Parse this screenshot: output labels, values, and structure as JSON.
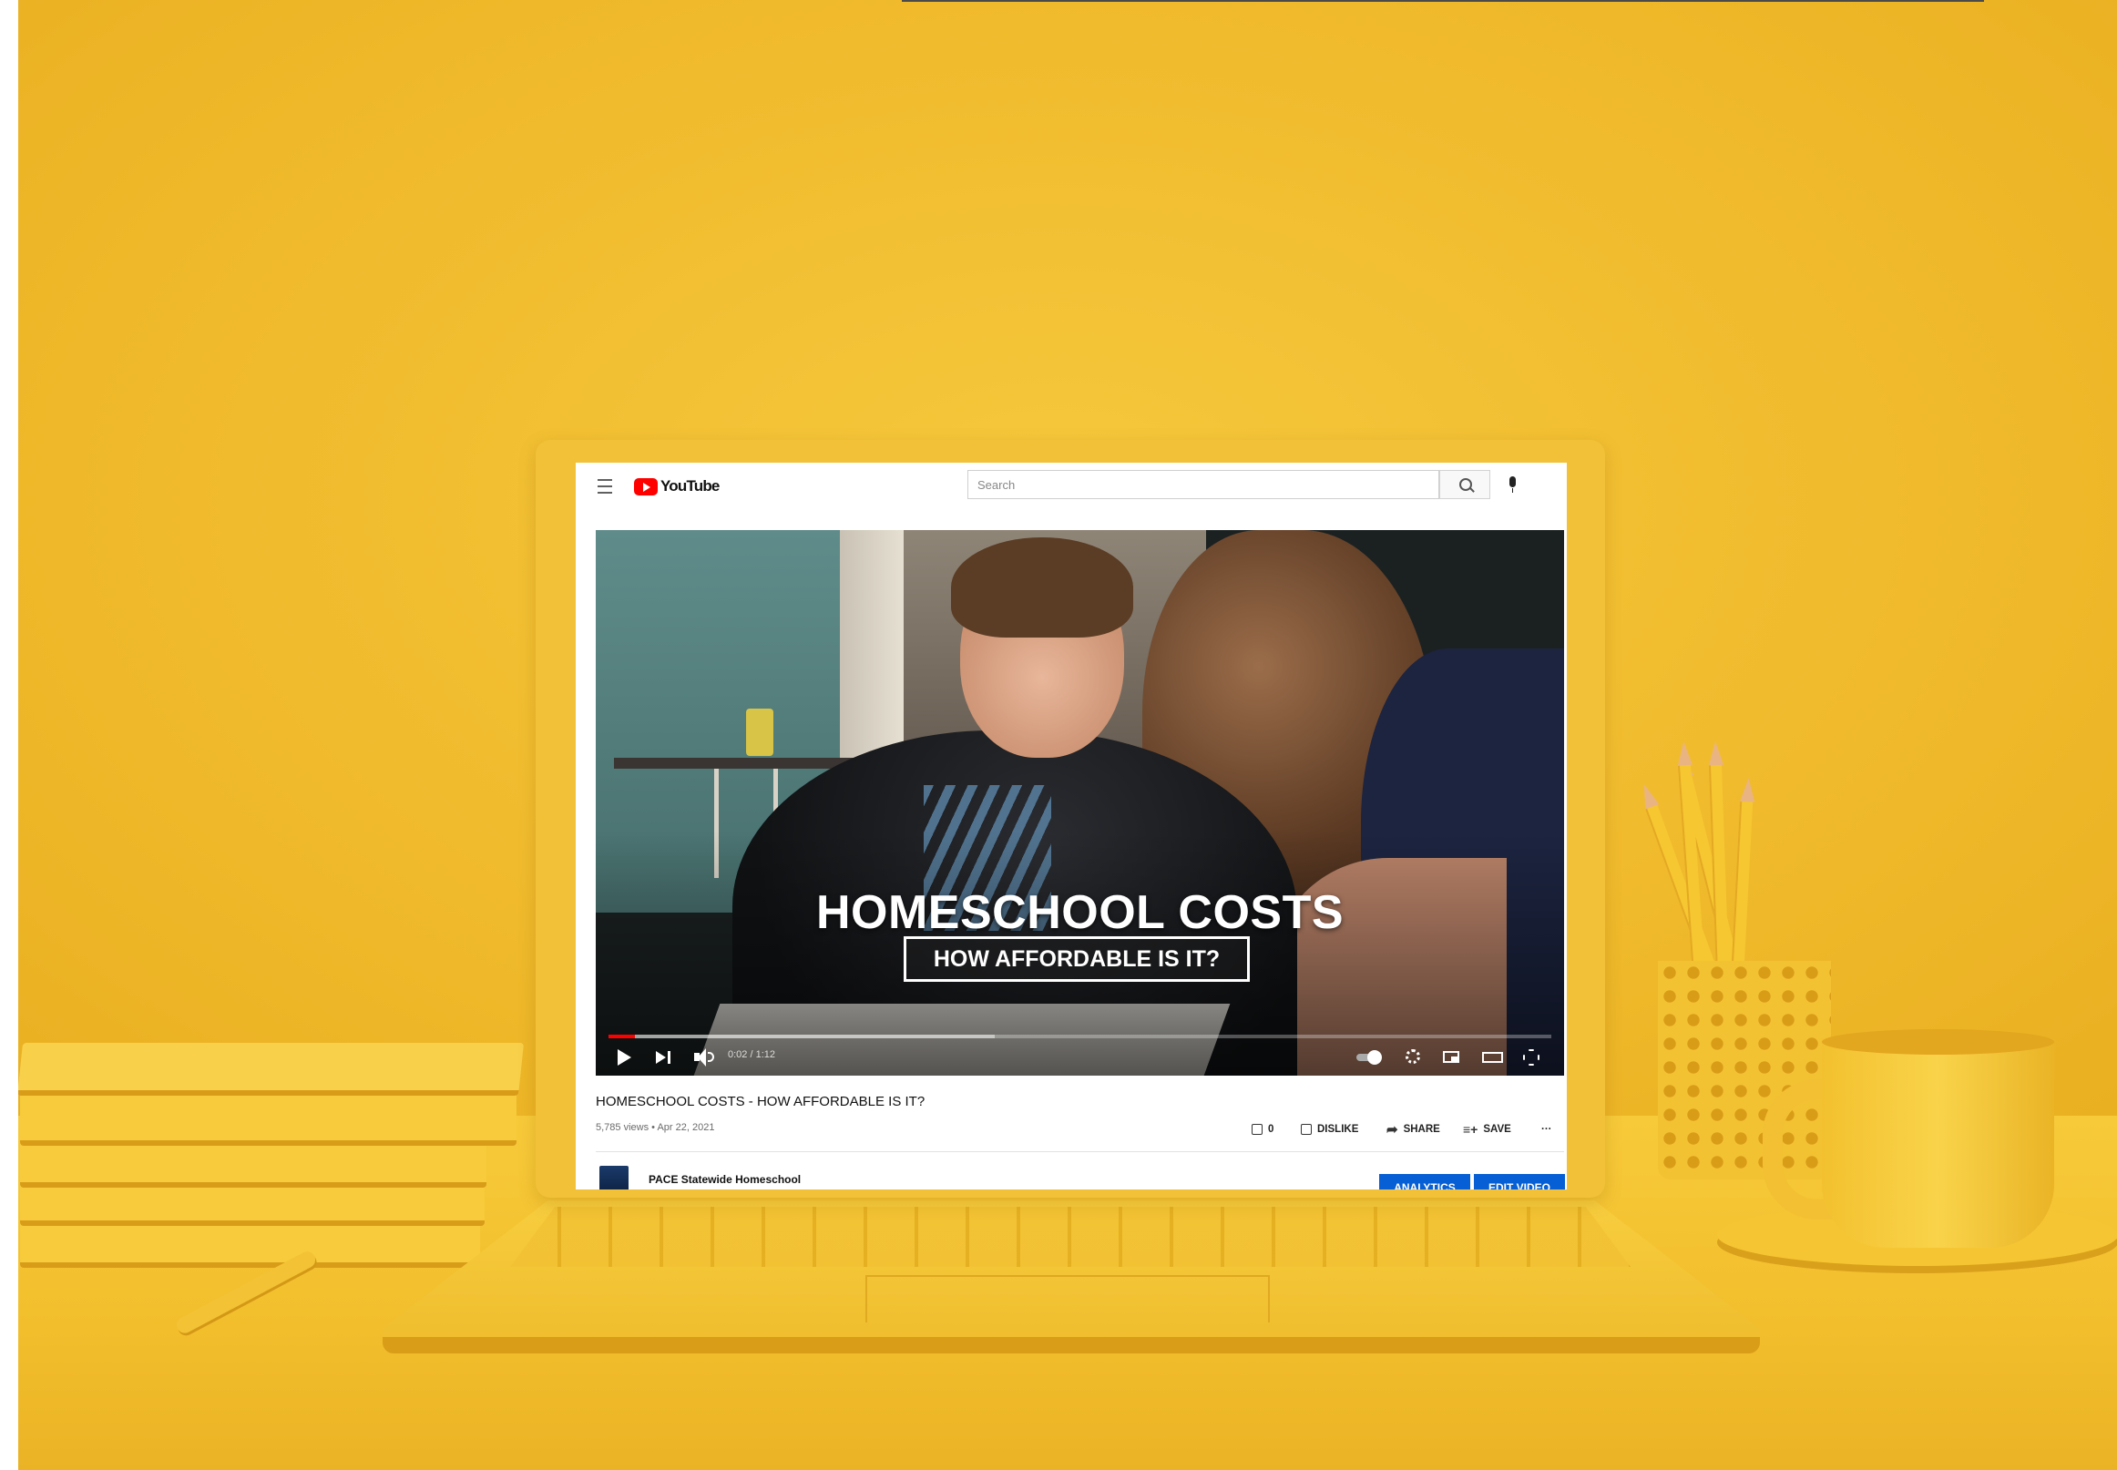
{
  "header": {
    "menu_icon": "hamburger-menu-icon",
    "logo_text": "YouTube",
    "search_placeholder": "Search",
    "search_icon": "search-icon",
    "mic_icon": "microphone-icon"
  },
  "player": {
    "overlay_title": "HOMESCHOOL COSTS",
    "overlay_subtitle": "HOW AFFORDABLE IS IT?",
    "time": "0:02 / 1:12",
    "progress_fraction": 0.028,
    "buffered_fraction": 0.41,
    "controls": [
      "play-icon",
      "next-icon",
      "volume-icon",
      "autoplay-toggle-icon",
      "settings-gear-icon",
      "miniplayer-icon",
      "theater-mode-icon",
      "fullscreen-icon"
    ]
  },
  "video": {
    "title": "HOMESCHOOL COSTS - HOW AFFORDABLE IS IT?",
    "meta": "5,785 views • Apr 22, 2021"
  },
  "actions": {
    "like_count": "0",
    "dislike_label": "DISLIKE",
    "share_label": "SHARE",
    "save_label": "SAVE",
    "more_label": "···"
  },
  "channel": {
    "name": "PACE Statewide Homeschool",
    "analytics_label": "ANALYTICS",
    "edit_label": "EDIT VIDEO"
  },
  "colors": {
    "brand_red": "#ff0000",
    "button_blue": "#065fd4",
    "background_yellow": "#f0bc2e"
  }
}
